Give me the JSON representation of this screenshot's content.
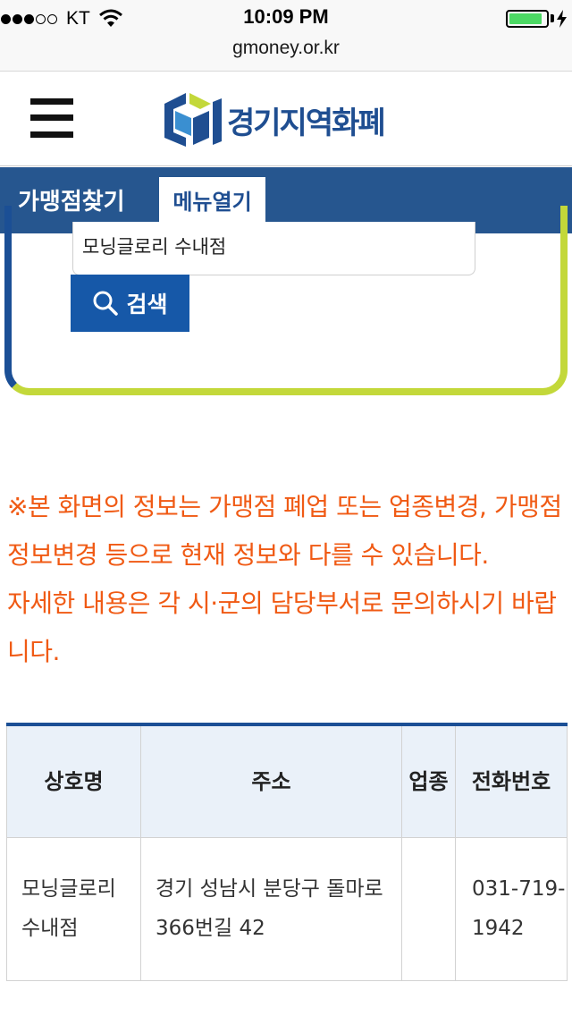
{
  "status_bar": {
    "carrier": "KT",
    "time": "10:09 PM",
    "signal_bars_filled": 3,
    "signal_bars_total": 5,
    "battery_level": 0.9,
    "battery_color": "#4cd964"
  },
  "browser": {
    "url": "gmoney.or.kr"
  },
  "header": {
    "logo_text": "경기지역화폐",
    "menu_icon": "hamburger-icon"
  },
  "subbar": {
    "title": "가맹점찾기",
    "menu_button": "메뉴열기"
  },
  "search": {
    "query": "모닝글로리 수내점",
    "button_label": "검색",
    "button_icon": "search-icon"
  },
  "notice": {
    "text": "※본 화면의 정보는 가맹점 폐업 또는 업종변경, 가맹점 정보변경 등으로 현재 정보와 다를 수 있습니다.",
    "detail": "자세한 내용은 각 시·군의 담당부서로 문의하시기 바랍니다.",
    "color": "#f05a14"
  },
  "table": {
    "headers": [
      "상호명",
      "주소",
      "업종",
      "전화번호"
    ],
    "rows": [
      {
        "name": "모닝글로리 수내점",
        "address": "경기 성남시 분당구 돌마로366번길 42",
        "category": "",
        "phone": "031-719-1942"
      }
    ]
  },
  "colors": {
    "brand_blue": "#26568f",
    "accent_lime": "#c3d83a",
    "button_blue": "#1658a8"
  }
}
